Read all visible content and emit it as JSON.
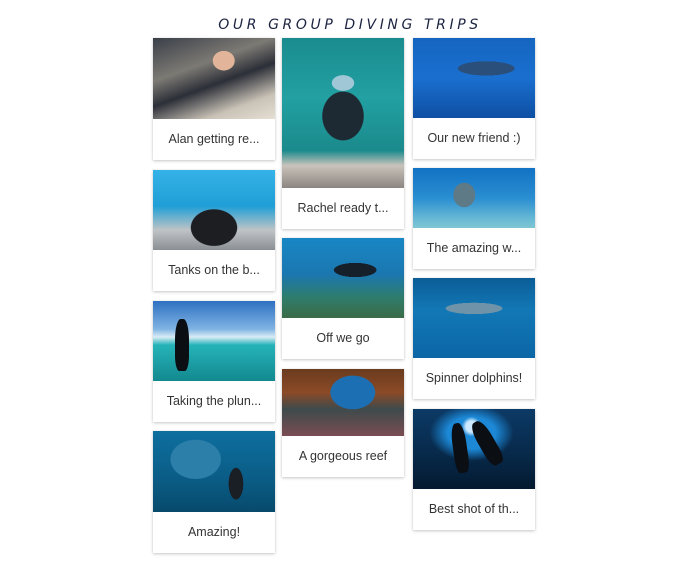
{
  "page": {
    "title": "OUR GROUP DIVING TRIPS"
  },
  "gallery": {
    "columns": [
      {
        "cards": [
          {
            "caption": "Alan getting re...",
            "image": "man-in-wetsuit-on-boat"
          },
          {
            "caption": "Tanks on the b...",
            "image": "scuba-tanks-on-boat"
          },
          {
            "caption": "Taking the plun...",
            "image": "diver-stepping-off-boat"
          },
          {
            "caption": "Amazing!",
            "image": "diver-with-fish-school"
          }
        ]
      },
      {
        "cards": [
          {
            "caption": "Rachel ready t...",
            "image": "diver-on-ladder"
          },
          {
            "caption": "Off we go",
            "image": "divers-over-reef"
          },
          {
            "caption": "A gorgeous reef",
            "image": "diver-in-coral-reef"
          }
        ]
      },
      {
        "cards": [
          {
            "caption": "Our new friend :)",
            "image": "whale-shark"
          },
          {
            "caption": "The amazing w...",
            "image": "shipwreck-with-divers"
          },
          {
            "caption": "Spinner dolphins!",
            "image": "spinner-dolphins"
          },
          {
            "caption": "Best shot of th...",
            "image": "diver-silhouettes"
          }
        ]
      }
    ]
  }
}
